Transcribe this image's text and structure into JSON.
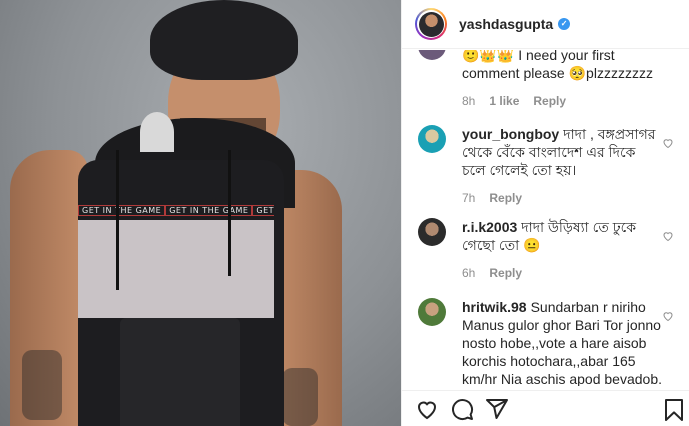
{
  "post": {
    "username": "yashdasgupta",
    "band_text": "GET IN THE GAME"
  },
  "comments": [
    {
      "partial_text": "I need your first comment please",
      "emoji_suffix": "🥺plzzzzzzzz",
      "time": "8h",
      "likes": "1 like",
      "reply": "Reply"
    },
    {
      "username": "your_bongboy",
      "text": "দাদা , বঙ্গপ্রসাগর থেকে বেঁকে বাংলাদেশ এর দিকে চলে গেলেই তো হয়।",
      "time": "7h",
      "reply": "Reply"
    },
    {
      "username": "r.i.k2003",
      "text": "দাদা উড়িষ্যা তে ঢুকে গেছো তো 😐",
      "time": "6h",
      "reply": "Reply"
    },
    {
      "username": "hritwik.98",
      "text": "Sundarban r niriho Manus gulor ghor Bari Tor jonno nosto hobe,,vote a hare aisob korchis hotochara,,abar 165 km/hr Nia aschis apod bevadob. by d way pic is fabulous"
    }
  ],
  "icons": {
    "like": "heart-icon",
    "comment": "comment-icon",
    "share": "send-icon",
    "save": "bookmark-icon",
    "verified": "verified-badge-icon"
  },
  "colors": {
    "verified": "#3897f0",
    "meta": "#8e8e8e"
  }
}
